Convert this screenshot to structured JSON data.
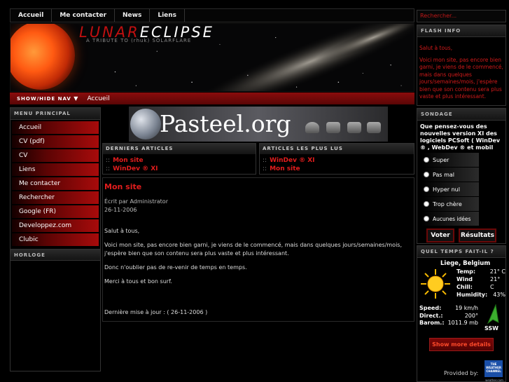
{
  "nav": {
    "items": [
      {
        "label": "Accueil"
      },
      {
        "label": "Me contacter"
      },
      {
        "label": "News"
      },
      {
        "label": "Liens"
      }
    ]
  },
  "header": {
    "logo_part1": "LUNAR",
    "logo_part2": "ECLIPSE",
    "tagline": "A TRIBUTE TO (rhuk) SOLARFLARE"
  },
  "breadcrumb": {
    "toggle": "SHOW/HIDE NAV",
    "toggle_arrow": "▼",
    "current": "Accueil"
  },
  "left": {
    "menu_title": "MENU PRINCIPAL",
    "menu": [
      {
        "label": "Accueil"
      },
      {
        "label": "CV (pdf)"
      },
      {
        "label": "CV"
      },
      {
        "label": "Liens"
      },
      {
        "label": "Me contacter"
      },
      {
        "label": "Rechercher"
      },
      {
        "label": "Google (FR)"
      },
      {
        "label": "Developpez.com"
      },
      {
        "label": "Clubic"
      }
    ],
    "clock_title": "HORLOGE"
  },
  "banner": {
    "text": "Pasteel.org"
  },
  "latest": {
    "title": "DERNIERS ARTICLES",
    "bullet": "::",
    "items": [
      {
        "label": "Mon site"
      },
      {
        "label": "WinDev ® XI"
      }
    ]
  },
  "popular": {
    "title": "ARTICLES LES PLUS LUS",
    "bullet": "::",
    "items": [
      {
        "label": "WinDev ® XI"
      },
      {
        "label": "Mon site"
      }
    ]
  },
  "article": {
    "title": "Mon site",
    "author": "Écrit par Administrator",
    "date": "26-11-2006",
    "p1": "Salut à tous,",
    "p2": "Voici mon site, pas encore bien garni, je viens de le commencé, mais dans quelques jours/semaines/mois, j'espère bien que son contenu sera plus vaste et plus intéressant.",
    "p3": "Donc n'oublier pas de re-venir de temps en temps.",
    "p4": "Merci à tous et bon surf.",
    "updated": "Dernière mise à jour : ( 26-11-2006 )"
  },
  "right": {
    "search_placeholder": "Rechercher...",
    "flash_title": "FLASH INFO",
    "flash_p1": "Salut à tous,",
    "flash_p2": "Voici mon site, pas encore bien garni, je viens de le commencé, mais dans quelques jours/semaines/mois, j'espère bien que son contenu sera plus vaste et plus intéressant.",
    "poll_title": "SONDAGE",
    "poll_question": "Que pensez-vous des nouvelles version XI des logiciels PCSoft ( WinDev ® , WebDev ® et mobil",
    "poll_options": [
      {
        "label": "Super"
      },
      {
        "label": "Pas mal"
      },
      {
        "label": "Hyper nul"
      },
      {
        "label": "Trop chère"
      },
      {
        "label": "Aucunes idées"
      }
    ],
    "vote_label": "Voter",
    "results_label": "Résultats",
    "weather_title": "QUEL TEMPS FAIT-IL ?",
    "weather": {
      "city": "Liege, Belgium",
      "temp_label": "Temp:",
      "temp_value": "21° C",
      "windchill_label": "Wind Chill:",
      "windchill_value": "21° C",
      "humidity_label": "Humidity:",
      "humidity_value": "43%",
      "speed_label": "Speed:",
      "speed_value": "19 km/h",
      "direct_label": "Direct.:",
      "direct_value": "200°",
      "barom_label": "Barom.:",
      "barom_value": "1011.9 mb",
      "wind_dir": "SSW"
    },
    "show_more": "Show more details",
    "provided_by": "Provided by:",
    "provider_badge_line1": "THE",
    "provider_badge_line2": "WEATHER",
    "provider_badge_line3": "CHANNEL",
    "provider_url": "weather.com"
  },
  "colors": {
    "accent_red": "#e21d1d",
    "menu_red": "#a80b0b",
    "background": "#000000"
  },
  "icons": [
    "chevron-down-icon",
    "globe-icon",
    "sun-icon",
    "wind-arrow-icon",
    "radio-icon"
  ]
}
